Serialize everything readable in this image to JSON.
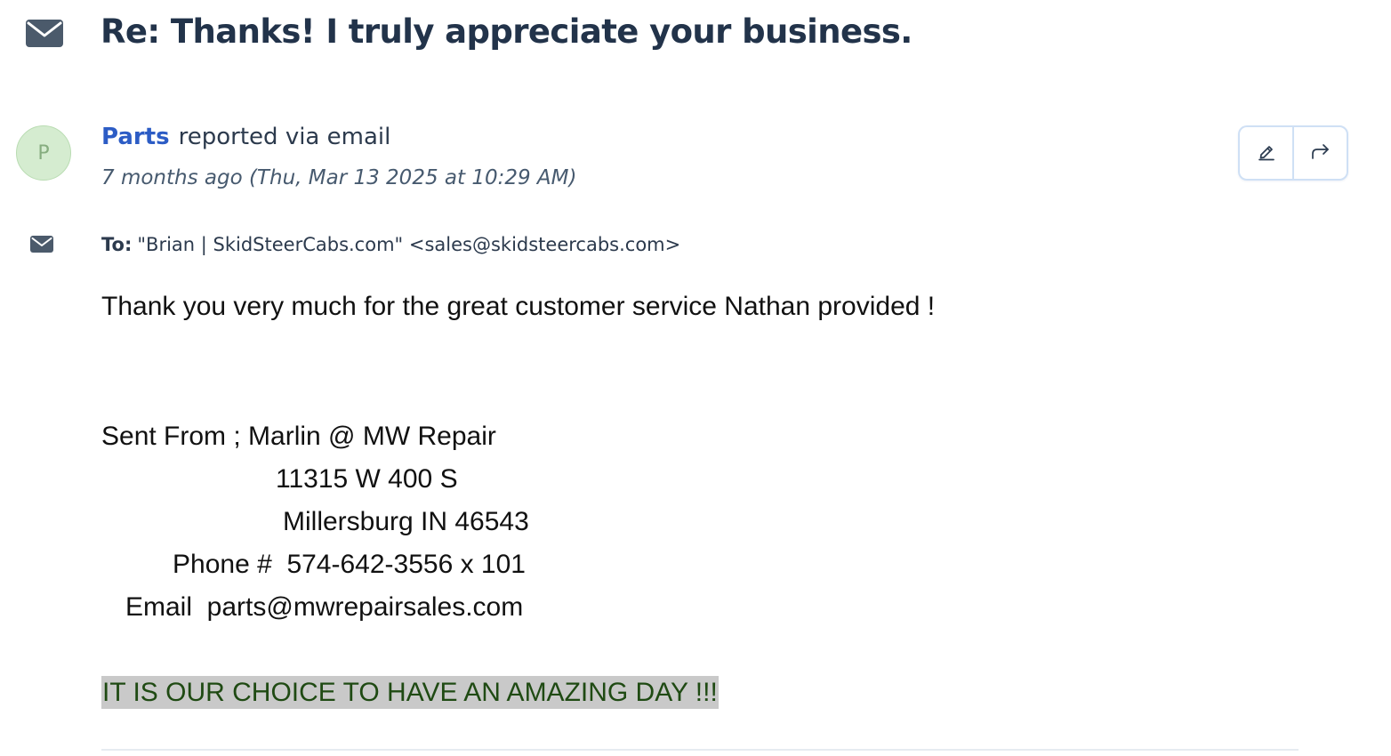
{
  "ticket": {
    "title": "Re: Thanks! I truly appreciate your business."
  },
  "message": {
    "avatar_initial": "P",
    "requester_name": "Parts",
    "reported_via": "reported via email",
    "timestamp": "7 months ago (Thu, Mar 13 2025 at 10:29 AM)",
    "to_label": "To:",
    "to_value": "\"Brian | SkidSteerCabs.com\" <sales@skidsteercabs.com>",
    "body": {
      "line1": "Thank you very much for the great customer service Nathan provided !",
      "sent_from": "Sent From ; Marlin @ MW Repair",
      "address1": "11315 W 400 S",
      "address2": "Millersburg IN 46543",
      "phone": "Phone #  574-642-3556 x 101",
      "email": "Email  parts@mwrepairsales.com",
      "motto": "IT IS OUR CHOICE TO HAVE AN AMAZING DAY !!!"
    }
  },
  "icons": {
    "header": "envelope-icon",
    "to": "envelope-icon",
    "edit": "pencil-icon",
    "forward": "forward-arrow-icon"
  },
  "colors": {
    "title": "#22334a",
    "requester_link": "#2c5cc5",
    "avatar_bg": "#d5ecd0",
    "avatar_text": "#86ad7f",
    "motto_highlight": "#c9c9c9",
    "motto_text": "#1f4a13",
    "button_border": "#cfe0f5"
  }
}
